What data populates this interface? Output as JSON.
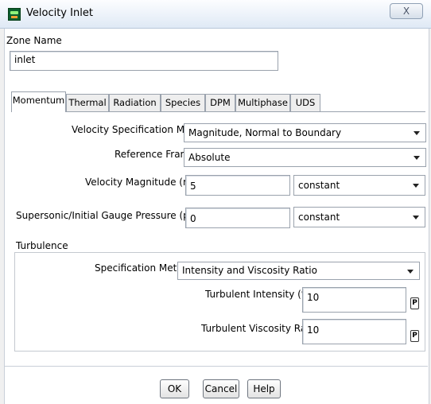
{
  "window": {
    "title": "Velocity Inlet",
    "close_label": "X"
  },
  "zone": {
    "label": "Zone Name",
    "value": "inlet"
  },
  "tabs": [
    "Momentum",
    "Thermal",
    "Radiation",
    "Species",
    "DPM",
    "Multiphase",
    "UDS"
  ],
  "active_tab": "Momentum",
  "momentum": {
    "velocity_spec": {
      "label": "Velocity Specification Method",
      "value": "Magnitude, Normal to Boundary"
    },
    "reference_frame": {
      "label": "Reference Frame",
      "value": "Absolute"
    },
    "velocity_magnitude": {
      "label": "Velocity Magnitude (m/s)",
      "value": "5",
      "profile": "constant"
    },
    "gauge_pressure": {
      "label": "Supersonic/Initial Gauge Pressure (pascal)",
      "value": "0",
      "profile": "constant"
    }
  },
  "turbulence": {
    "heading": "Turbulence",
    "spec_method": {
      "label": "Specification Method",
      "value": "Intensity and Viscosity Ratio"
    },
    "intensity": {
      "label": "Turbulent Intensity (%)",
      "value": "10",
      "param": "P"
    },
    "viscosity_ratio": {
      "label": "Turbulent Viscosity Ratio",
      "value": "10",
      "param": "P"
    }
  },
  "buttons": {
    "ok": "OK",
    "cancel": "Cancel",
    "help": "Help"
  }
}
